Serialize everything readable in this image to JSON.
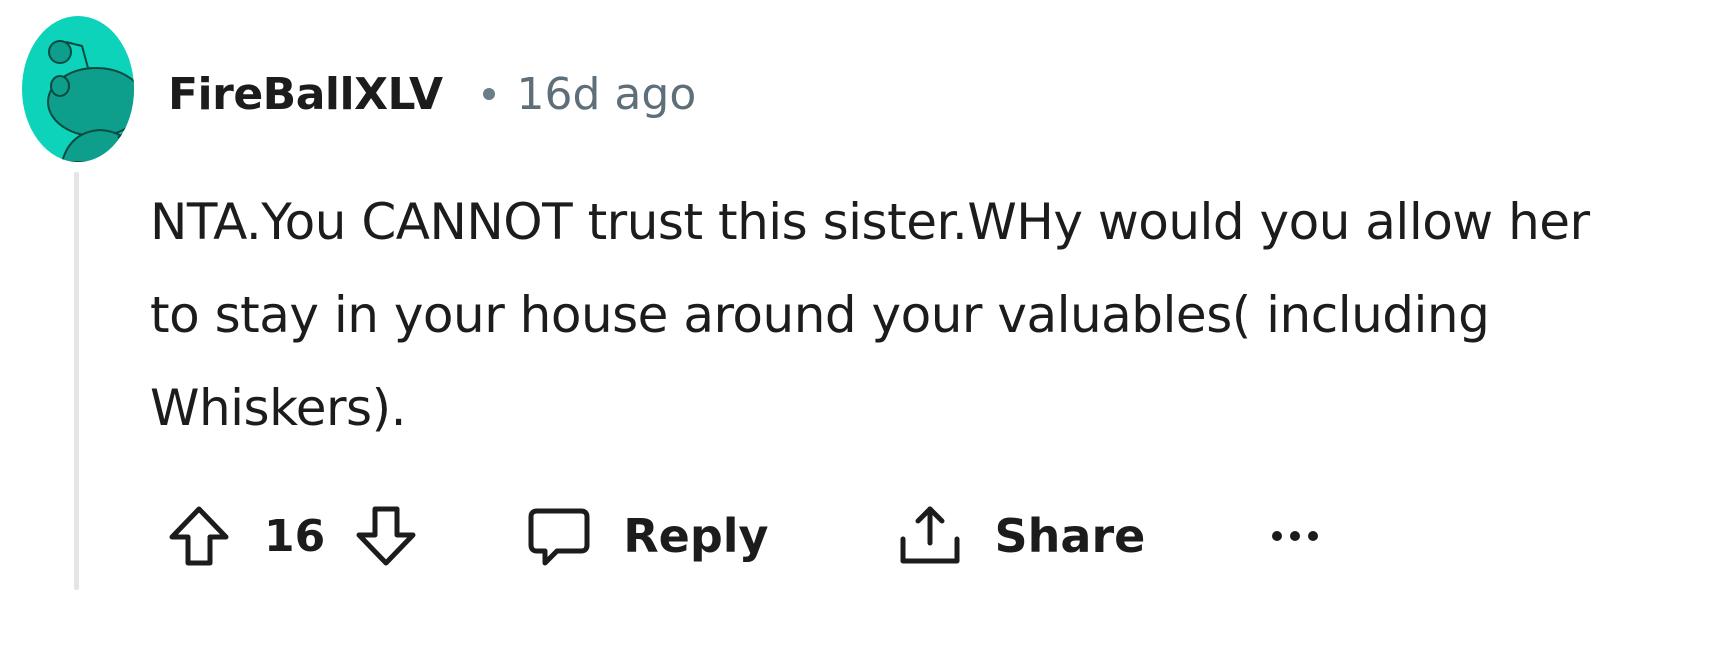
{
  "comment": {
    "author": "FireBallXLV",
    "age": "16d ago",
    "body": "NTA.You CANNOT trust this sister.WHy would you allow her to stay in your house around your valuables( including Whiskers).",
    "score": "16"
  },
  "actions": {
    "reply_label": "Reply",
    "share_label": "Share"
  },
  "colors": {
    "avatar_bg": "#0dd3bb",
    "avatar_figure": "#0e9e8c",
    "meta_text": "#5f6f7a",
    "text": "#1c1c1c",
    "thread_line": "#e5e5e5"
  },
  "icons": {
    "avatar": "reddit-snoo-avatar",
    "upvote": "arrow-up-outline-icon",
    "downvote": "arrow-down-outline-icon",
    "reply": "speech-bubble-icon",
    "share": "share-upload-icon",
    "more": "ellipsis-icon"
  }
}
